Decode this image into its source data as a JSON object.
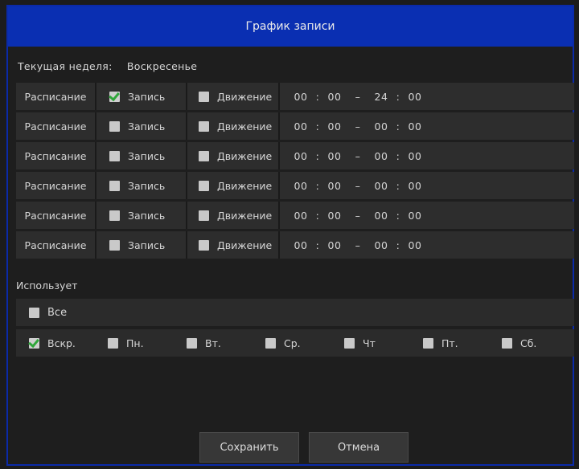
{
  "title": "График записи",
  "current_week": {
    "label": "Текущая неделя:",
    "value": "Воскресенье"
  },
  "schedule_rows": [
    {
      "label": "Расписание",
      "record_label": "Запись",
      "record_checked": true,
      "motion_label": "Движение",
      "motion_checked": false,
      "start_h": "00",
      "start_m": "00",
      "end_h": "24",
      "end_m": "00"
    },
    {
      "label": "Расписание",
      "record_label": "Запись",
      "record_checked": false,
      "motion_label": "Движение",
      "motion_checked": false,
      "start_h": "00",
      "start_m": "00",
      "end_h": "00",
      "end_m": "00"
    },
    {
      "label": "Расписание",
      "record_label": "Запись",
      "record_checked": false,
      "motion_label": "Движение",
      "motion_checked": false,
      "start_h": "00",
      "start_m": "00",
      "end_h": "00",
      "end_m": "00"
    },
    {
      "label": "Расписание",
      "record_label": "Запись",
      "record_checked": false,
      "motion_label": "Движение",
      "motion_checked": false,
      "start_h": "00",
      "start_m": "00",
      "end_h": "00",
      "end_m": "00"
    },
    {
      "label": "Расписание",
      "record_label": "Запись",
      "record_checked": false,
      "motion_label": "Движение",
      "motion_checked": false,
      "start_h": "00",
      "start_m": "00",
      "end_h": "00",
      "end_m": "00"
    },
    {
      "label": "Расписание",
      "record_label": "Запись",
      "record_checked": false,
      "motion_label": "Движение",
      "motion_checked": false,
      "start_h": "00",
      "start_m": "00",
      "end_h": "00",
      "end_m": "00"
    }
  ],
  "time_colon": ":",
  "time_dash": "–",
  "uses_label": "Использует",
  "all": {
    "label": "Все",
    "checked": false
  },
  "days": [
    {
      "label": "Вскр.",
      "checked": true
    },
    {
      "label": "Пн.",
      "checked": false
    },
    {
      "label": "Вт.",
      "checked": false
    },
    {
      "label": "Ср.",
      "checked": false
    },
    {
      "label": "Чт",
      "checked": false
    },
    {
      "label": "Пт.",
      "checked": false
    },
    {
      "label": "Сб.",
      "checked": false
    }
  ],
  "buttons": {
    "save": "Сохранить",
    "cancel": "Отмена"
  },
  "colors": {
    "title_bar": "#0a2fb2",
    "check_mark": "#2fa53a"
  }
}
